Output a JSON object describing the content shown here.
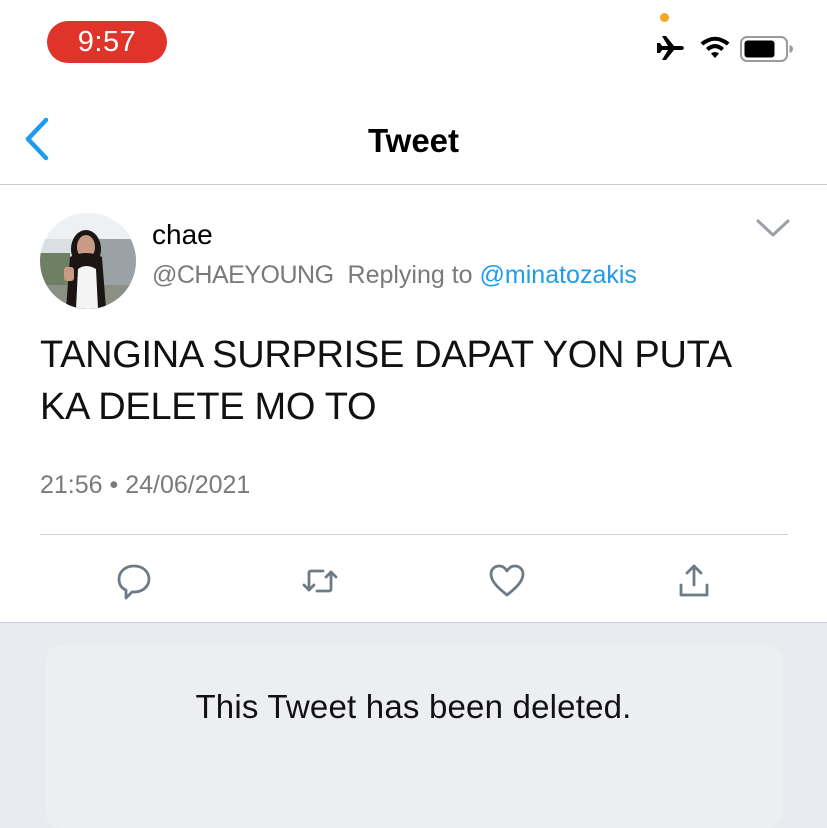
{
  "status_bar": {
    "time": "9:57",
    "icons": [
      "airplane-icon",
      "wifi-icon",
      "battery-icon"
    ],
    "accent_time_pill": "#e0332a"
  },
  "nav": {
    "title": "Tweet",
    "back_icon": "chevron-left-icon",
    "accent": "#1d9bf0"
  },
  "tweet": {
    "author_name": "chae",
    "handle": "@CHAEYOUNG",
    "replying_label": "Replying to",
    "replying_to": "@minatozakis",
    "text_line1": "TANGINA SURPRISE DAPAT YON PUTA",
    "text_line2": "KA DELETE MO TO",
    "timestamp": "21:56 • 24/06/2021",
    "actions": [
      "reply-icon",
      "retweet-icon",
      "like-icon",
      "share-icon"
    ]
  },
  "quoted": {
    "deleted_message": "This Tweet has been deleted."
  }
}
